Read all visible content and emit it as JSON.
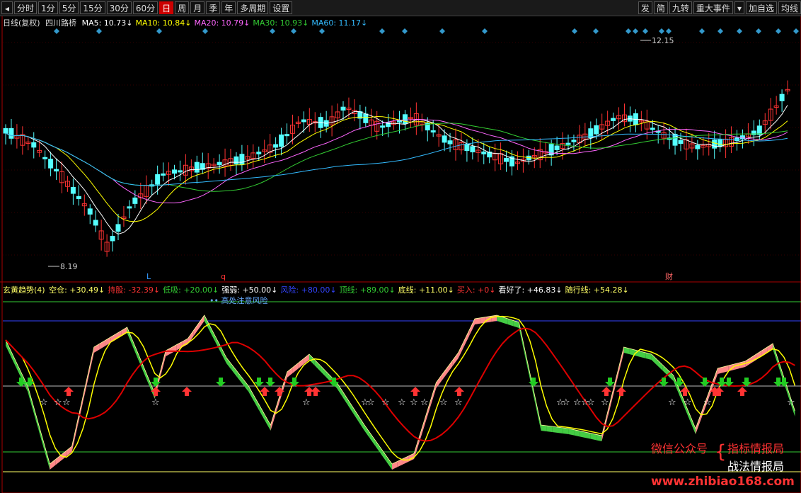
{
  "toolbar": {
    "left": [
      "分时",
      "1分",
      "5分",
      "15分",
      "30分",
      "60分",
      "日",
      "周",
      "月",
      "季",
      "年",
      "多周期",
      "设置"
    ],
    "active": "日",
    "right": [
      "发",
      "简",
      "九转",
      "重大事件",
      "加自选",
      "均线"
    ]
  },
  "main_info": {
    "title": "日线(复权)",
    "stock": "四川路桥",
    "ma": [
      {
        "label": "MA5: 10.73",
        "color": "#ffffff"
      },
      {
        "label": "MA10: 10.84",
        "color": "#ffff00"
      },
      {
        "label": "MA20: 10.79",
        "color": "#ff66ff"
      },
      {
        "label": "MA30: 10.93",
        "color": "#33cc33"
      },
      {
        "label": "MA60: 11.17",
        "color": "#33bbff"
      }
    ]
  },
  "price_marks": {
    "high": "12.15",
    "low": "8.19"
  },
  "event_marks": [
    {
      "text": "L",
      "color": "#3399ff"
    },
    {
      "text": "q",
      "color": "#ff3333"
    },
    {
      "text": "财",
      "color": "#ff6666"
    }
  ],
  "indicator_info": {
    "title": "玄黄趋势(4)",
    "items": [
      {
        "label": "空仓: +30.49",
        "color": "#ffff66"
      },
      {
        "label": "持股: -32.39",
        "color": "#ff3333"
      },
      {
        "label": "低吸: +20.00",
        "color": "#33cc33"
      },
      {
        "label": "强弱: +50.00",
        "color": "#ffffff"
      },
      {
        "label": "风险: +80.00",
        "color": "#3344ff"
      },
      {
        "label": "顶线: +89.00",
        "color": "#33cc33"
      },
      {
        "label": "底线: +11.00",
        "color": "#ffff66"
      },
      {
        "label": "买入: +0",
        "color": "#ff3333"
      },
      {
        "label": "看好了: +46.83",
        "color": "#ffffff"
      },
      {
        "label": "随行线: +54.28",
        "color": "#ffff66"
      }
    ],
    "risk_note": "高处注意风险"
  },
  "watermark": {
    "wechat": "微信公众号",
    "line1": "指标情报局",
    "line2": "战法情报局",
    "url": "www.zhibiao168.com"
  },
  "colors": {
    "up_candle": "#ff3333",
    "down_candle": "#54ffff",
    "ma5": "#ffffff",
    "ma10": "#ffff00",
    "ma20": "#ff66ff",
    "ma30": "#33cc33",
    "ma60": "#33bbff",
    "red_line": "#dd0000",
    "yellow_line": "#ffff00",
    "thin_line": "#ffff99",
    "ribbon_up": "#ff8888",
    "ribbon_down": "#44cc44",
    "buy_arrow": "#ff3333",
    "sell_arrow": "#22cc22"
  }
}
